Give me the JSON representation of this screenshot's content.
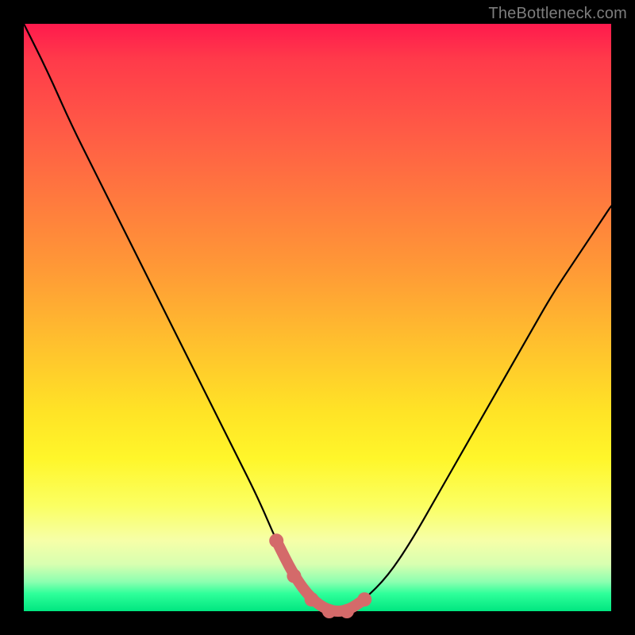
{
  "watermark": "TheBottleneck.com",
  "palette": {
    "curve_stroke": "#000000",
    "accent_stroke": "#d46a6a",
    "accent_fill": "#d46a6a"
  },
  "chart_data": {
    "type": "line",
    "title": "",
    "xlabel": "",
    "ylabel": "",
    "xlim": [
      0,
      100
    ],
    "ylim": [
      0,
      100
    ],
    "grid": false,
    "series": [
      {
        "name": "bottleneck-curve",
        "x": [
          0,
          4,
          8,
          12,
          16,
          20,
          24,
          28,
          32,
          36,
          40,
          43,
          46,
          49,
          52,
          55,
          58,
          62,
          66,
          70,
          74,
          78,
          82,
          86,
          90,
          94,
          98,
          100
        ],
        "y": [
          100,
          92,
          83,
          75,
          67,
          59,
          51,
          43,
          35,
          27,
          19,
          12,
          6,
          2,
          0,
          0,
          2,
          6,
          12,
          19,
          26,
          33,
          40,
          47,
          54,
          60,
          66,
          69
        ]
      }
    ],
    "accent_region": {
      "name": "recommended-range",
      "x": [
        43,
        46,
        49,
        52,
        55,
        58
      ],
      "y": [
        12,
        6,
        2,
        0,
        0,
        2
      ],
      "marker_radius_px": 9,
      "stroke_width_px": 14
    }
  }
}
